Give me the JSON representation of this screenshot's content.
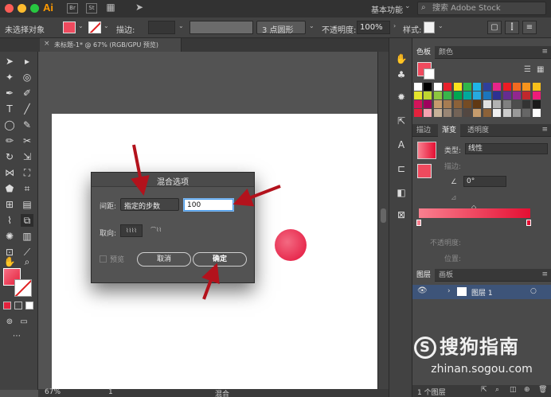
{
  "titlebar": {
    "app_logo": "Ai",
    "workspace": "基本功能",
    "stock_search_placeholder": "搜索 Adobe Stock",
    "icons": [
      "bridge-icon",
      "stock-icon",
      "arrange-documents-icon",
      "gpu-rocket-icon"
    ]
  },
  "controlbar": {
    "no_selection": "未选择对象",
    "stroke_label": "描边:",
    "brush_label": "3 点圆形",
    "opacity_label": "不透明度:",
    "opacity_value": "100%",
    "style_label": "样式:",
    "colors": {
      "fill": "#ef4a5e",
      "stroke_none": "#e02020"
    }
  },
  "document": {
    "tab_title": "未标题-1* @ 67% (RGB/GPU 预览)"
  },
  "status": {
    "zoom": "67%",
    "artboard": "1",
    "tool": "混合"
  },
  "dialog": {
    "title": "混合选项",
    "spacing_label": "间距:",
    "spacing_value": "指定的步数",
    "steps_value": "100",
    "orientation_label": "取向:",
    "preview_label": "预览",
    "cancel_label": "取消",
    "ok_label": "确定"
  },
  "panels": {
    "swatches_tabs": [
      "色板",
      "颜色"
    ],
    "gradient_tabs": [
      "描边",
      "渐变",
      "透明度"
    ],
    "gradient_type_label": "类型:",
    "gradient_type_value": "线性",
    "stroke_label": "描边:",
    "angle_value": "0°",
    "opacity_label": "不透明度:",
    "location_label": "位置:",
    "layers_tabs": [
      "图层",
      "画板"
    ],
    "layer_name": "图层 1",
    "layer_count": "1 个图层",
    "gradient_colors": {
      "start": "#f9808f",
      "end": "#e50f33"
    }
  },
  "watermark": {
    "brand": "搜狗指南",
    "url": "zhinan.sogou.com"
  }
}
